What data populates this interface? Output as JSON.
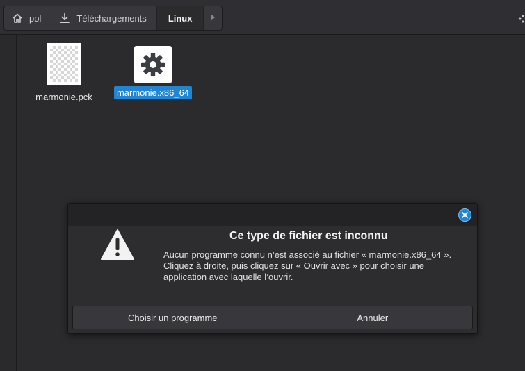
{
  "breadcrumb": {
    "items": [
      {
        "label": "pol",
        "icon": "home-icon"
      },
      {
        "label": "Téléchargements",
        "icon": "download-icon"
      },
      {
        "label": "Linux",
        "icon": ""
      }
    ],
    "next_icon": "chevron-right-icon"
  },
  "files": [
    {
      "name": "marmonie.pck",
      "icon": "image-file-icon",
      "selected": false
    },
    {
      "name": "marmonie.x86_64",
      "icon": "gear-icon",
      "selected": true
    }
  ],
  "dialog": {
    "title": "Ce type de fichier est inconnu",
    "message_lines": [
      "Aucun programme connu n’est associé au fichier « marmonie.x86_64 ».",
      "Cliquez à droite, puis cliquez sur « Ouvrir avec » pour choisir une",
      "application avec laquelle l’ouvrir."
    ],
    "buttons": {
      "choose": "Choisir un programme",
      "cancel": "Annuler"
    },
    "icon": "warning-icon"
  },
  "colors": {
    "accent": "#1f86d6",
    "background": "#2b2b2e"
  }
}
